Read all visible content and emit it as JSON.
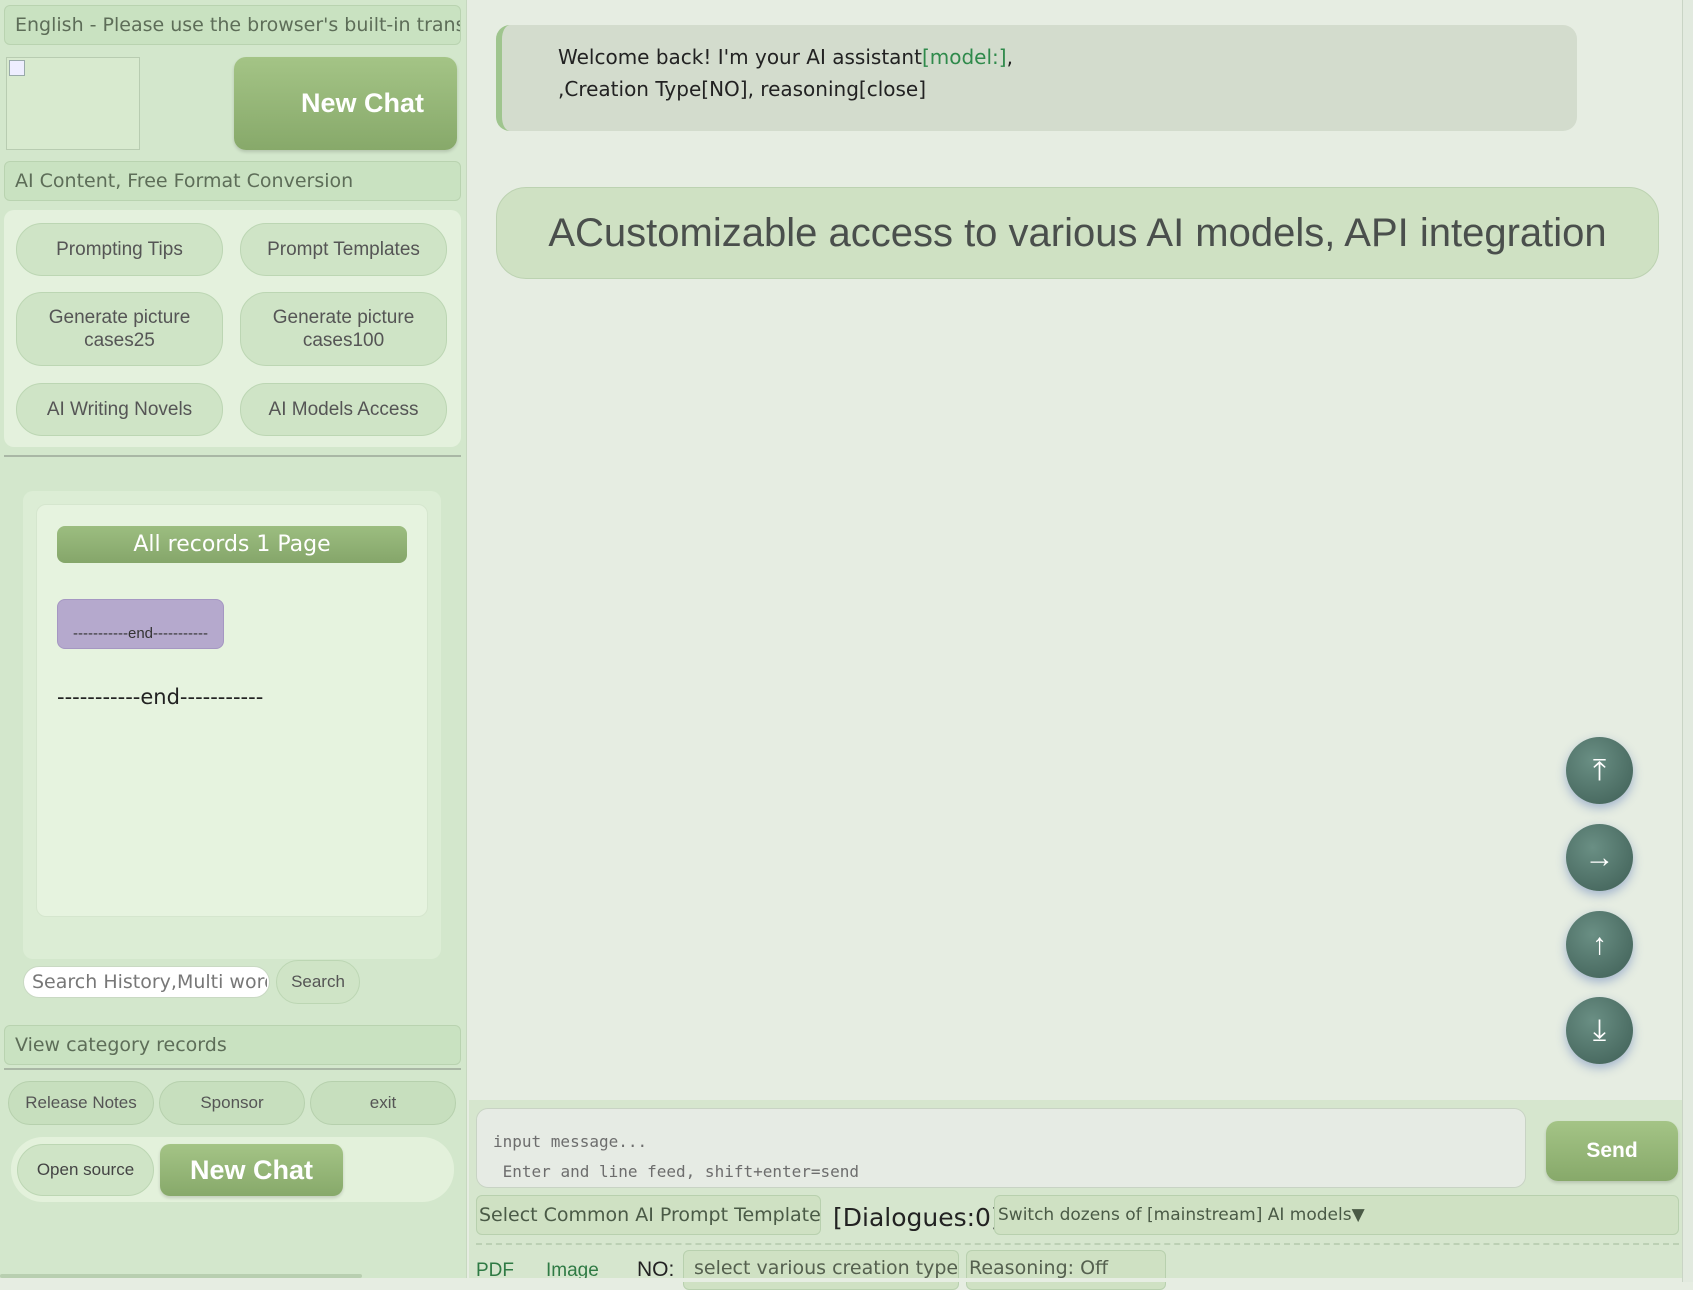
{
  "sidebar": {
    "language_bar": "English - Please use the browser's built-in translation",
    "new_chat_top": "New Chat",
    "content_conversion": "AI Content, Free Format Conversion",
    "quick_buttons": [
      "Prompting Tips",
      "Prompt Templates",
      "Generate picture cases25",
      "Generate picture cases100",
      "AI Writing Novels",
      "AI Models Access"
    ],
    "records_header": "All records 1 Page",
    "end_chip": "-----------end-----------",
    "end_text": "-----------end-----------",
    "search_placeholder": "Search History,Multi word",
    "search_button": "Search",
    "category_records": "View category records",
    "footer_buttons": [
      "Release Notes",
      "Sponsor",
      "exit"
    ],
    "open_source": "Open source",
    "new_chat_bottom": "New Chat"
  },
  "main": {
    "welcome_line1_prefix": "Welcome back! I'm your AI assistant",
    "welcome_model": "[model:]",
    "welcome_line1_suffix": ",",
    "welcome_line2": ",Creation Type[NO],  reasoning[close]",
    "banner": "ACustomizable access to various AI models, API integration",
    "fab_icons": [
      "⤒",
      "→",
      "↑",
      "⤓"
    ]
  },
  "composer": {
    "placeholder": "input message...\n Enter and line feed, shift+enter=send",
    "send": "Send",
    "template_select": "Select Common AI Prompt Templates",
    "dialogues": "[Dialogues:0]",
    "model_select": "Switch dozens of [mainstream] AI models▼",
    "pdf": "PDF",
    "image": "Image",
    "no_label": "NO:",
    "creation_type": "select various creation types",
    "reasoning": "Reasoning: Off"
  }
}
